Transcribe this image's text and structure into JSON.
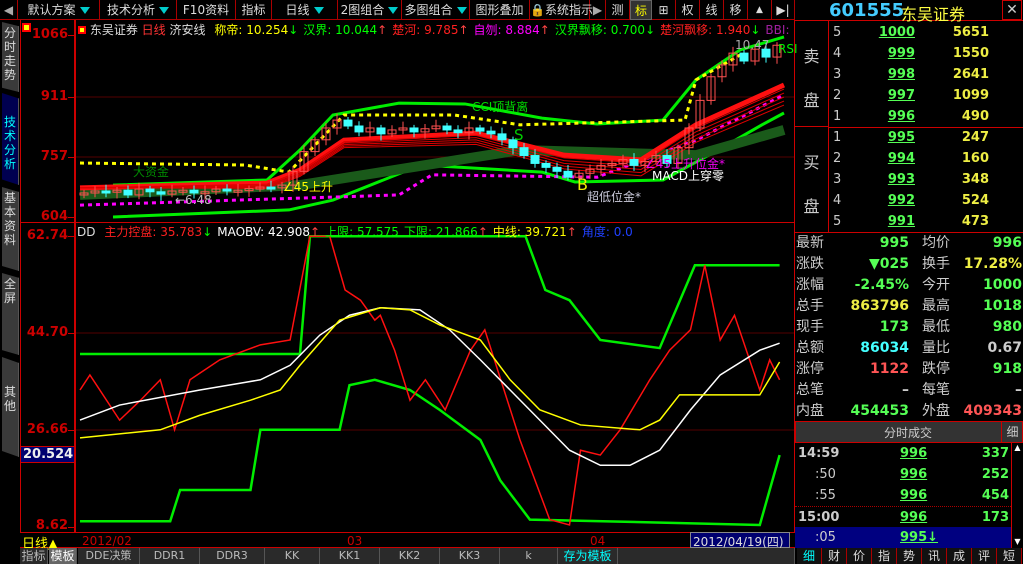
{
  "toolbar": {
    "back_icon": "◀",
    "items": [
      "默认方案",
      "技术分析",
      "F10资料",
      "指标",
      "日线",
      "2图组合",
      "多图组合",
      "图形叠加",
      "系统指示",
      "▶",
      "测",
      "标",
      "⊞",
      "权",
      "线",
      "移",
      "▲",
      "▶|"
    ]
  },
  "left_tabs": [
    "分时走势",
    "技术分析",
    "基本资料",
    "全屏",
    "其他"
  ],
  "upper_axis": {
    "labels": [
      "1066",
      "911",
      "757",
      "604"
    ]
  },
  "lower_axis": {
    "labels": [
      "62.74",
      "44.70",
      "26.66",
      "8.62"
    ],
    "cursor_value": "20.524"
  },
  "upper_header": {
    "stock": "东吴证券",
    "period": "日线",
    "indicator": "济安线",
    "items": [
      {
        "name": "称帝",
        "value": "10.254",
        "arrow": "↓",
        "color": "#ffff00"
      },
      {
        "name": "汉界",
        "value": "10.044",
        "arrow": "↑",
        "color": "#00ff00"
      },
      {
        "name": "楚河",
        "value": "9.785",
        "arrow": "↑",
        "color": "#ff2020"
      },
      {
        "name": "自刎",
        "value": "8.884",
        "arrow": "↑",
        "color": "#ff00ff"
      },
      {
        "name": "汉界飘移",
        "value": "0.700",
        "arrow": "↓",
        "color": "#00ff00"
      },
      {
        "name": "楚河飘移",
        "value": "1.940",
        "arrow": "↓",
        "color": "#ff2020"
      },
      {
        "name": "BBI",
        "value": "",
        "arrow": "",
        "color": "#a020a0"
      }
    ]
  },
  "lower_header": {
    "indicator": "DD",
    "items": [
      {
        "name": "主力控盘",
        "value": "35.783",
        "arrow": "↓",
        "color": "#ff2020"
      },
      {
        "name": "MAOBV",
        "value": "42.908",
        "arrow": "↑",
        "color": "#ffffff"
      },
      {
        "name": "上限",
        "value": "57.575",
        "arrow": "",
        "color": "#00ff00"
      },
      {
        "name": "下限",
        "value": "21.866",
        "arrow": "↑",
        "color": "#00ff00"
      },
      {
        "name": "中线",
        "value": "39.721",
        "arrow": "↑",
        "color": "#ffff00"
      },
      {
        "name": "角度",
        "value": "0.0",
        "arrow": "",
        "color": "#2040ff"
      }
    ]
  },
  "annotations": {
    "cci": "CCI顶背离",
    "s": "S",
    "big_money": "大资金",
    "rise45_left": "∠45上升",
    "low_marker": "←6.48",
    "b": "B",
    "b_low": "超低位金*",
    "rise45_right": "∠45上升位金*",
    "macd": "MACD上穿零",
    "rsi": "RSI",
    "high_marker": "10.47"
  },
  "date_axis": {
    "period_label": "日线",
    "labels": [
      "2012/02",
      "03",
      "04"
    ],
    "cursor_date": "2012/04/19(四)"
  },
  "bottom_tabs": [
    "指标",
    "模板",
    "DDE决策",
    "DDR1",
    "DDR3",
    "KK",
    "KK1",
    "KK2",
    "KK3",
    "k",
    "存为模板"
  ],
  "quote": {
    "code": "601555",
    "name": "东吴证券",
    "sell_label": [
      "卖",
      "盘"
    ],
    "buy_label": [
      "买",
      "盘"
    ],
    "asks": [
      {
        "level": "5",
        "price": "1000",
        "vol": "5651"
      },
      {
        "level": "4",
        "price": "999",
        "vol": "1550"
      },
      {
        "level": "3",
        "price": "998",
        "vol": "2641"
      },
      {
        "level": "2",
        "price": "997",
        "vol": "1099"
      },
      {
        "level": "1",
        "price": "996",
        "vol": "490"
      }
    ],
    "bids": [
      {
        "level": "1",
        "price": "995",
        "vol": "247"
      },
      {
        "level": "2",
        "price": "994",
        "vol": "160"
      },
      {
        "level": "3",
        "price": "993",
        "vol": "348"
      },
      {
        "level": "4",
        "price": "992",
        "vol": "524"
      },
      {
        "level": "5",
        "price": "991",
        "vol": "473"
      }
    ],
    "stats": [
      {
        "l1": "最新",
        "v1": "995",
        "c1": "#5f5",
        "l2": "均价",
        "v2": "996",
        "c2": "#5f5"
      },
      {
        "l1": "涨跌",
        "v1": "▼025",
        "c1": "#5f5",
        "l2": "换手",
        "v2": "17.28%",
        "c2": "#ee4"
      },
      {
        "l1": "涨幅",
        "v1": "-2.45%",
        "c1": "#5f5",
        "l2": "今开",
        "v2": "1000",
        "c2": "#5f5"
      },
      {
        "l1": "总手",
        "v1": "863796",
        "c1": "#ee4",
        "l2": "最高",
        "v2": "1018",
        "c2": "#5f5"
      },
      {
        "l1": "现手",
        "v1": "173",
        "c1": "#5f5",
        "l2": "最低",
        "v2": "980",
        "c2": "#5f5"
      },
      {
        "l1": "总额",
        "v1": "86034",
        "c1": "#4ff",
        "l2": "量比",
        "v2": "0.67",
        "c2": "#ccc"
      },
      {
        "l1": "涨停",
        "v1": "1122",
        "c1": "#f55",
        "l2": "跌停",
        "v2": "918",
        "c2": "#5f5"
      },
      {
        "l1": "总笔",
        "v1": "–",
        "c1": "#ccc",
        "l2": "每笔",
        "v2": "–",
        "c2": "#ccc"
      },
      {
        "l1": "内盘",
        "v1": "454453",
        "c1": "#5f5",
        "l2": "外盘",
        "v2": "409343",
        "c2": "#f55"
      }
    ],
    "trades_title": "分时成交",
    "trades_detail": "细",
    "trades": [
      {
        "time": "14:59",
        "price": "996",
        "vol": "337"
      },
      {
        "time": ":50",
        "price": "996",
        "vol": "252"
      },
      {
        "time": ":55",
        "price": "996",
        "vol": "454"
      },
      {
        "time": "15:00",
        "price": "996",
        "vol": "173"
      },
      {
        "time": ":05",
        "price": "995↓",
        "vol": ""
      }
    ],
    "tabs": [
      "细",
      "财",
      "价",
      "指",
      "势",
      "讯",
      "成",
      "评",
      "短"
    ]
  },
  "chart_data": [
    {
      "type": "candlestick",
      "pane": "upper",
      "ylim": [
        604,
        1066
      ],
      "x_unit": "trading day index",
      "closes": [
        665,
        670,
        668,
        672,
        660,
        675,
        668,
        662,
        670,
        672,
        665,
        668,
        675,
        670,
        672,
        676,
        680,
        678,
        685,
        720,
        770,
        800,
        830,
        850,
        835,
        820,
        830,
        815,
        825,
        830,
        820,
        828,
        835,
        825,
        818,
        830,
        822,
        815,
        800,
        780,
        760,
        740,
        730,
        720,
        705,
        715,
        725,
        735,
        740,
        750,
        735,
        745,
        760,
        740,
        780,
        830,
        900,
        960,
        990,
        1020,
        1000,
        1030,
        1010,
        1040
      ],
      "overlays": [
        {
          "name": "upper_band",
          "color": "#00ee00",
          "points": [
            [
              3,
              685
            ],
            [
              17,
              698
            ],
            [
              20,
              774
            ],
            [
              23,
              863
            ],
            [
              29,
              893
            ],
            [
              35,
              891
            ],
            [
              42,
              855
            ],
            [
              47,
              840
            ],
            [
              53,
              850
            ],
            [
              56,
              952
            ],
            [
              60,
              1028
            ],
            [
              64,
              1061
            ]
          ]
        },
        {
          "name": "lower_band",
          "color": "#00ee00",
          "points": [
            [
              3,
              604
            ],
            [
              19,
              622
            ],
            [
              23,
              647
            ],
            [
              31,
              736
            ],
            [
              42,
              718
            ],
            [
              45,
              693
            ],
            [
              53,
              698
            ],
            [
              58,
              774
            ],
            [
              62,
              838
            ],
            [
              64,
              868
            ]
          ]
        },
        {
          "name": "yellow_dash",
          "color": "#ffff00",
          "dash": true,
          "points": [
            [
              0,
              741
            ],
            [
              15,
              736
            ],
            [
              19,
              718
            ],
            [
              24,
              863
            ],
            [
              34,
              863
            ],
            [
              40,
              838
            ],
            [
              55,
              850
            ],
            [
              56,
              952
            ],
            [
              60,
              1015
            ]
          ]
        },
        {
          "name": "magenta_dash",
          "color": "#ff00ff",
          "dash": true,
          "points": [
            [
              0,
              634
            ],
            [
              29,
              660
            ],
            [
              32,
              711
            ],
            [
              47,
              705
            ],
            [
              56,
              799
            ],
            [
              64,
              914
            ]
          ]
        },
        {
          "name": "dark_green_band",
          "color": "#1a5a1a",
          "width": 10,
          "points": [
            [
              0,
              660
            ],
            [
              20,
              685
            ],
            [
              40,
              774
            ],
            [
              56,
              761
            ],
            [
              64,
              825
            ]
          ]
        },
        {
          "name": "red_ma",
          "color": "#ff1010",
          "width": 5,
          "points": [
            [
              0,
              678
            ],
            [
              17,
              690
            ],
            [
              20,
              723
            ],
            [
              24,
              799
            ],
            [
              36,
              817
            ],
            [
              44,
              761
            ],
            [
              51,
              749
            ],
            [
              56,
              838
            ],
            [
              64,
              939
            ]
          ]
        }
      ]
    },
    {
      "type": "line",
      "pane": "lower",
      "ylim": [
        8.62,
        62.74
      ],
      "x_unit": "trading day index",
      "series": [
        {
          "name": "上限",
          "color": "#00ee00",
          "points": [
            [
              0,
              40.8
            ],
            [
              20,
              40.8
            ],
            [
              20.9,
              62.7
            ],
            [
              40.5,
              62.7
            ],
            [
              42.3,
              52.7
            ],
            [
              44.5,
              50.8
            ],
            [
              47.3,
              43.4
            ],
            [
              52.7,
              41.9
            ],
            [
              55.9,
              57.3
            ],
            [
              63.6,
              57.3
            ]
          ]
        },
        {
          "name": "下限",
          "color": "#00ee00",
          "points": [
            [
              0,
              9.7
            ],
            [
              8.2,
              9.7
            ],
            [
              9.1,
              15.5
            ],
            [
              15.5,
              15.5
            ],
            [
              16.4,
              26.7
            ],
            [
              23.6,
              26.7
            ],
            [
              24.5,
              35.0
            ],
            [
              26.8,
              36.0
            ],
            [
              30,
              34.1
            ],
            [
              32.7,
              30.4
            ],
            [
              36.4,
              24.8
            ],
            [
              38.2,
              17.3
            ],
            [
              40.9,
              10.0
            ],
            [
              61.8,
              9.0
            ],
            [
              63.6,
              22.0
            ]
          ]
        },
        {
          "name": "主力控盘",
          "color": "#ff1010",
          "points": [
            [
              0,
              34.1
            ],
            [
              0.9,
              36.9
            ],
            [
              3.6,
              28.5
            ],
            [
              5.5,
              32.2
            ],
            [
              7.3,
              36.0
            ],
            [
              8.6,
              26.7
            ],
            [
              10,
              36.0
            ],
            [
              12.7,
              39.7
            ],
            [
              16.4,
              42.5
            ],
            [
              19.1,
              43.4
            ],
            [
              20.9,
              62.7
            ],
            [
              22.7,
              62.7
            ],
            [
              24.1,
              52.7
            ],
            [
              25.5,
              50.8
            ],
            [
              26.8,
              47.1
            ],
            [
              27.3,
              48.0
            ],
            [
              28.6,
              41.5
            ],
            [
              30,
              32.2
            ],
            [
              31.4,
              36.0
            ],
            [
              33.2,
              30.4
            ],
            [
              35.5,
              41.5
            ],
            [
              36.8,
              45.3
            ],
            [
              40,
              24.8
            ],
            [
              42.7,
              10.0
            ],
            [
              44.5,
              9.0
            ],
            [
              45.5,
              22.9
            ],
            [
              47.3,
              22.0
            ],
            [
              49.1,
              26.7
            ],
            [
              51.8,
              36.0
            ],
            [
              53.6,
              41.5
            ],
            [
              55.5,
              45.3
            ],
            [
              56.8,
              57.3
            ],
            [
              58.2,
              43.4
            ],
            [
              59.5,
              48.0
            ],
            [
              61.8,
              34.1
            ],
            [
              62.7,
              39.7
            ],
            [
              63.6,
              36.0
            ]
          ]
        },
        {
          "name": "MAOBV",
          "color": "#ffffff",
          "points": [
            [
              0,
              28.5
            ],
            [
              3.6,
              31.3
            ],
            [
              10.9,
              34.1
            ],
            [
              16.4,
              36.0
            ],
            [
              19.1,
              38.7
            ],
            [
              21.8,
              44.3
            ],
            [
              24.5,
              48.0
            ],
            [
              27.3,
              49.4
            ],
            [
              30.9,
              49.0
            ],
            [
              33.6,
              45.3
            ],
            [
              36.4,
              39.7
            ],
            [
              39.1,
              34.1
            ],
            [
              41.8,
              28.5
            ],
            [
              44.5,
              22.9
            ],
            [
              47.3,
              20.1
            ],
            [
              50,
              20.1
            ],
            [
              52.7,
              22.9
            ],
            [
              55.5,
              30.4
            ],
            [
              58.2,
              36.9
            ],
            [
              61.8,
              41.5
            ],
            [
              63.6,
              42.8
            ]
          ]
        },
        {
          "name": "中线",
          "color": "#ffff00",
          "points": [
            [
              0,
              25.2
            ],
            [
              7.3,
              26.7
            ],
            [
              10.9,
              29.4
            ],
            [
              15.5,
              32.2
            ],
            [
              18.2,
              34.1
            ],
            [
              20,
              38.7
            ],
            [
              23.6,
              47.1
            ],
            [
              27.3,
              49.4
            ],
            [
              30,
              49.0
            ],
            [
              32.7,
              46.2
            ],
            [
              36.4,
              43.4
            ],
            [
              39.1,
              36.0
            ],
            [
              41.8,
              30.4
            ],
            [
              45.5,
              27.6
            ],
            [
              50.9,
              26.7
            ],
            [
              52.7,
              28.5
            ],
            [
              54.5,
              33.2
            ],
            [
              61.8,
              33.2
            ],
            [
              63.6,
              39.3
            ]
          ]
        }
      ]
    }
  ]
}
